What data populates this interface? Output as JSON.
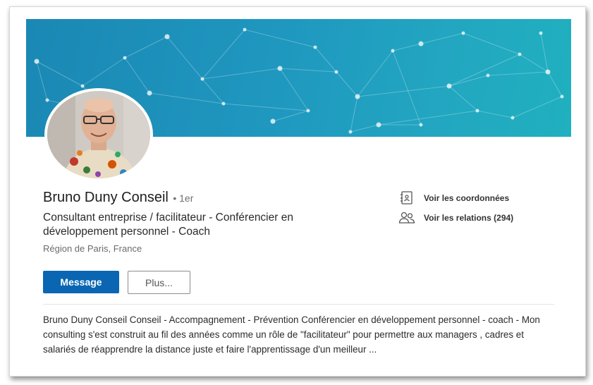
{
  "profile": {
    "name": "Bruno Duny Conseil",
    "degree": "• 1er",
    "headline": "Consultant entreprise / facilitateur - Conférencier en développement personnel - Coach",
    "location": "Région de Paris, France",
    "summary": "Bruno Duny Conseil Conseil - Accompagnement - Prévention Conférencier en développement personnel - coach - Mon consulting s'est construit au fil des années comme un rôle de \"facilitateur\" pour permettre aux managers , cadres et salariés de réapprendre la distance juste et faire l'apprentissage d'un meilleur ..."
  },
  "actions": {
    "message_label": "Message",
    "more_label": "Plus..."
  },
  "contact": {
    "coordinates_label": "Voir les coordonnées",
    "coordinates_icon": "contact-card-icon",
    "relations_label": "Voir les relations (294)",
    "relations_icon": "people-icon"
  },
  "colors": {
    "banner": "#1f97bf",
    "primary_button": "#0a66b2"
  }
}
